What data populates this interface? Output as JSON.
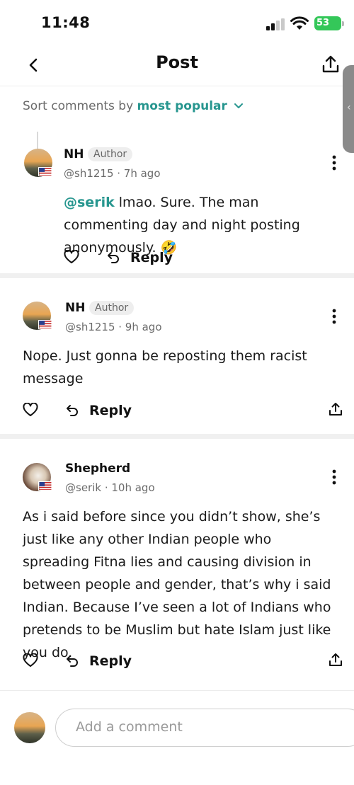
{
  "status_bar": {
    "time": "11:48",
    "battery": "53"
  },
  "header": {
    "title": "Post"
  },
  "sort": {
    "label": "Sort comments by",
    "value": "most popular"
  },
  "colors": {
    "accent": "#27968f",
    "battery": "#34c759"
  },
  "comments": [
    {
      "name": "NH",
      "badge": "Author",
      "handle": "@sh1215 · 7h ago",
      "mention": "@serik",
      "text": " lmao. Sure. The man commenting day and night posting anonymously. 🤣",
      "reply_label": "Reply"
    },
    {
      "name": "NH",
      "badge": "Author",
      "handle": "@sh1215 · 9h ago",
      "text": "Nope. Just gonna be reposting them racist message",
      "reply_label": "Reply"
    },
    {
      "name": "Shepherd",
      "handle": "@serik · 10h ago",
      "text": "As i said before since you didn’t show, she’s just like any other Indian people who spreading Fitna lies and causing division in between people and gender, that’s why i said Indian. Because I’ve seen a lot of Indians who pretends to be Muslim but hate Islam just like you do.",
      "reply_label": "Reply"
    }
  ],
  "composer": {
    "placeholder": "Add a comment"
  },
  "icons": [
    "back-icon",
    "share-icon",
    "chevron-down-icon",
    "kebab-icon",
    "heart-icon",
    "reply-icon",
    "us-flag-icon",
    "signal-icon",
    "wifi-icon"
  ]
}
